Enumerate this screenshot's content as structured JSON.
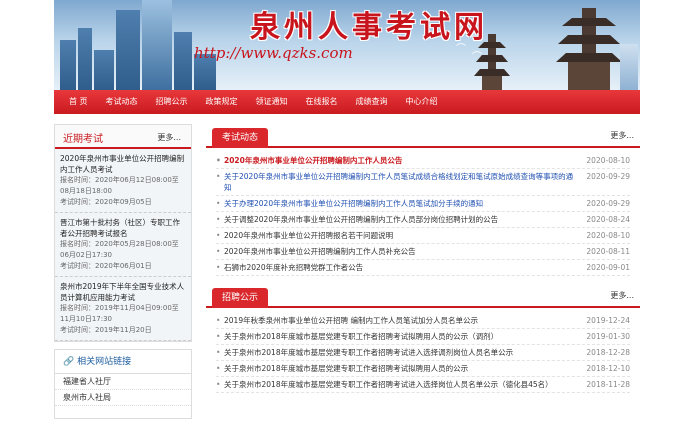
{
  "banner": {
    "title": "泉州人事考试网",
    "url": "http://www.qzks.com"
  },
  "nav": [
    "首 页",
    "考试动态",
    "招聘公示",
    "政策规定",
    "领证通知",
    "在线报名",
    "成绩查询",
    "中心介绍"
  ],
  "sidebar": {
    "recent_title": "近期考试",
    "recent_more": "更多...",
    "exams": [
      {
        "title": "2020年泉州市事业单位公开招聘编制内工作人员考试",
        "signup": "报名时间：2020年06月12日08:00至08月18日18:00",
        "exam": "考试时间：2020年09月05日"
      },
      {
        "title": "晋江市第十批村务（社区）专职工作者公开招聘考试报名",
        "signup": "报名时间：2020年05月28日08:00至06月02日17:30",
        "exam": "考试时间：2020年06月01日"
      },
      {
        "title": "泉州市2019年下半年全国专业技术人员计算机应用能力考试",
        "signup": "报名时间：2019年11月04日09:00至11月10日17:30",
        "exam": "考试时间：2019年11月20日"
      }
    ],
    "links_title": "相关网站链接",
    "links": [
      "福建省人社厅",
      "泉州市人社局"
    ]
  },
  "news": {
    "tab": "考试动态",
    "more": "更多...",
    "items": [
      {
        "title": "2020年泉州市事业单位公开招聘编制内工作人员公告",
        "date": "2020-08-10",
        "style": "red"
      },
      {
        "title": "关于2020年泉州市事业单位公开招聘编制内工作人员笔试成绩合格线划定和笔试原始成绩查询等事项的通知",
        "date": "2020-09-29",
        "style": "blue"
      },
      {
        "title": "关于办理2020年泉州市事业单位公开招聘编制内工作人员笔试加分手续的通知",
        "date": "2020-09-29",
        "style": "blue"
      },
      {
        "title": "关于调整2020年泉州市事业单位公开招聘编制内工作人员部分岗位招聘计划的公告",
        "date": "2020-08-24",
        "style": "normal"
      },
      {
        "title": "2020年泉州市事业单位公开招聘报名若干问题说明",
        "date": "2020-08-10",
        "style": "normal"
      },
      {
        "title": "2020年泉州市事业单位公开招聘编制内工作人员补充公告",
        "date": "2020-08-11",
        "style": "normal"
      },
      {
        "title": "石狮市2020年度补充招聘党群工作者公告",
        "date": "2020-09-01",
        "style": "normal"
      }
    ]
  },
  "publicity": {
    "tab": "招聘公示",
    "more": "更多...",
    "items": [
      {
        "title": "2019年秋季泉州市事业单位公开招聘 编制内工作人员笔试加分人员名单公示",
        "date": "2019-12-24"
      },
      {
        "title": "关于泉州市2018年度城市基层党建专职工作者招聘考试拟聘用人员的公示（调剂）",
        "date": "2019-01-30"
      },
      {
        "title": "关于泉州市2018年度城市基层党建专职工作者招聘考试进入选择调剂岗位人员名单公示",
        "date": "2018-12-28"
      },
      {
        "title": "关于泉州市2018年度城市基层党建专职工作者招聘考试拟聘用人员的公示",
        "date": "2018-12-10"
      },
      {
        "title": "关于泉州市2018年度城市基层党建专职工作者招聘考试进入选择岗位人员名单公示（德化县45名）",
        "date": "2018-11-28"
      }
    ]
  }
}
